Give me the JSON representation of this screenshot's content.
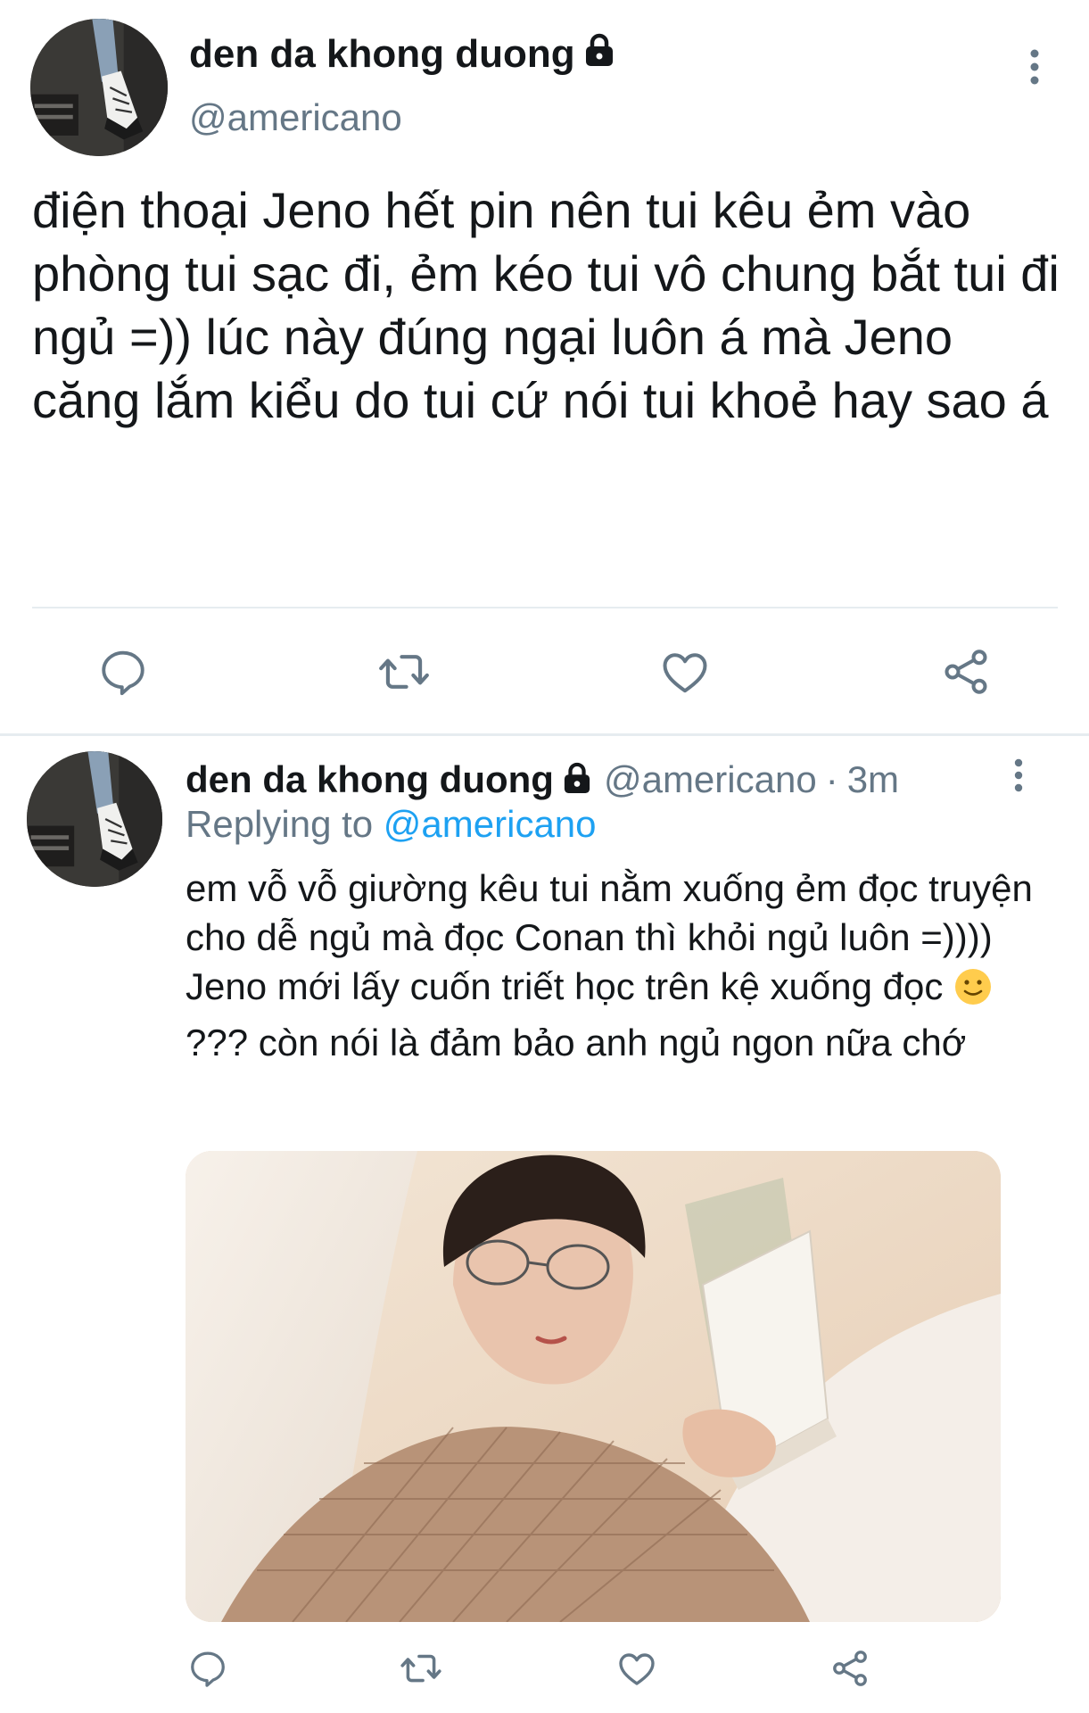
{
  "colors": {
    "name": "#14171a",
    "handle": "#657786",
    "link": "#1da1f2",
    "icon": "#657786",
    "divider": "#e6ecf0"
  },
  "main_tweet": {
    "display_name": "den da khong duong",
    "handle": "@americano",
    "protected_icon": "lock-icon",
    "more_icon": "more-vertical-icon",
    "text": "điện thoại Jeno hết pin nên tui kêu ẻm vào phòng tui sạc đi, ẻm kéo tui vô chung bắt tui đi ngủ =)) lúc này đúng ngại luôn á mà Jeno căng lắm kiểu do tui cứ nói tui khoẻ hay sao á",
    "actions": [
      "reply-icon",
      "retweet-icon",
      "like-icon",
      "share-icon"
    ]
  },
  "reply_tweet": {
    "display_name": "den da khong duong",
    "handle": "@americano",
    "separator": "·",
    "time": "3m",
    "replying_prefix": "Replying to",
    "replying_to": "@americano",
    "text_before_emoji": "em vỗ vỗ giường kêu tui nằm xuống ẻm đọc truyện cho dễ ngủ mà đọc Conan thì khỏi ngủ luôn =)))) Jeno mới lấy cuốn triết học trên kệ xuống đọc ",
    "emoji": "slightly-smiling-face-emoji",
    "text_after_emoji": " ??? còn nói là đảm bảo anh ngủ ngon nữa chớ",
    "media": "photo of a person in checked pajamas wearing glasses reading a book in bed",
    "actions": [
      "reply-icon",
      "retweet-icon",
      "like-icon",
      "share-icon"
    ]
  }
}
